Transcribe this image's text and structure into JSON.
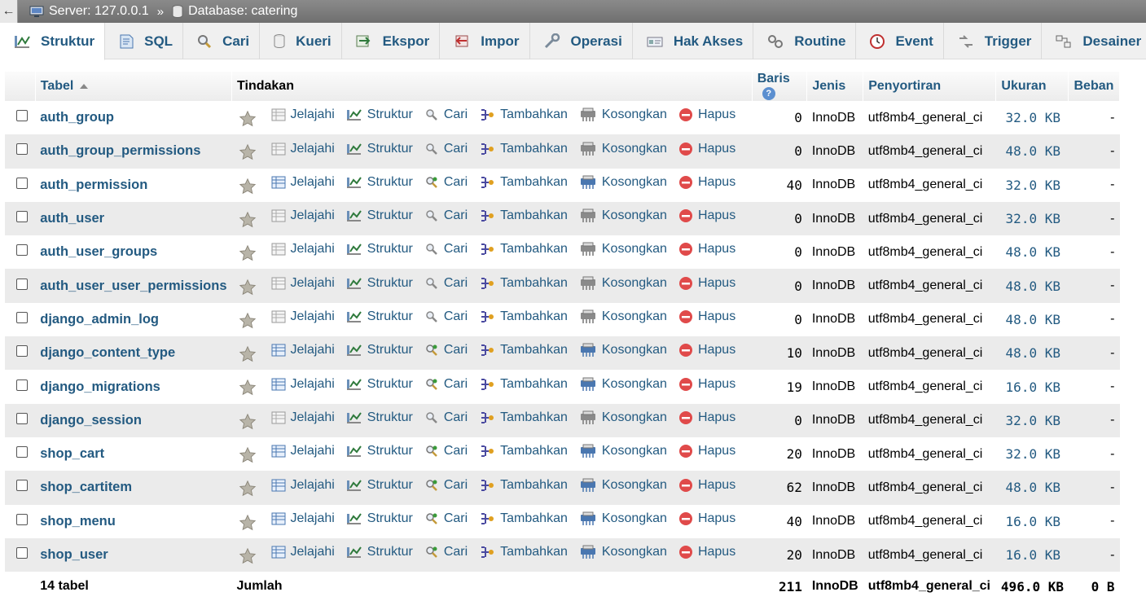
{
  "breadcrumb": {
    "back_label": "←",
    "server": "Server: 127.0.0.1",
    "separator": "»",
    "database": "Database: catering"
  },
  "tabs": [
    {
      "label": "Struktur",
      "icon": "structure-icon"
    },
    {
      "label": "SQL",
      "icon": "sql-icon"
    },
    {
      "label": "Cari",
      "icon": "search-icon"
    },
    {
      "label": "Kueri",
      "icon": "query-icon"
    },
    {
      "label": "Ekspor",
      "icon": "export-icon"
    },
    {
      "label": "Impor",
      "icon": "import-icon"
    },
    {
      "label": "Operasi",
      "icon": "wrench-icon"
    },
    {
      "label": "Hak Akses",
      "icon": "privileges-icon"
    },
    {
      "label": "Routine",
      "icon": "routines-icon"
    },
    {
      "label": "Event",
      "icon": "clock-icon"
    },
    {
      "label": "Trigger",
      "icon": "trigger-icon"
    },
    {
      "label": "Desainer",
      "icon": "designer-icon"
    }
  ],
  "table": {
    "headers": {
      "table": "Tabel",
      "actions": "Tindakan",
      "rows": "Baris",
      "type": "Jenis",
      "collation": "Penyortiran",
      "size": "Ukuran",
      "overhead": "Beban"
    },
    "actions": {
      "browse": "Jelajahi",
      "structure": "Struktur",
      "search": "Cari",
      "insert": "Tambahkan",
      "empty": "Kosongkan",
      "drop": "Hapus"
    },
    "rows": [
      {
        "name": "auth_group",
        "rows": "0",
        "type": "InnoDB",
        "collation": "utf8mb4_general_ci",
        "size": "32.0 KB",
        "overhead": "-"
      },
      {
        "name": "auth_group_permissions",
        "rows": "0",
        "type": "InnoDB",
        "collation": "utf8mb4_general_ci",
        "size": "48.0 KB",
        "overhead": "-"
      },
      {
        "name": "auth_permission",
        "rows": "40",
        "type": "InnoDB",
        "collation": "utf8mb4_general_ci",
        "size": "32.0 KB",
        "overhead": "-"
      },
      {
        "name": "auth_user",
        "rows": "0",
        "type": "InnoDB",
        "collation": "utf8mb4_general_ci",
        "size": "32.0 KB",
        "overhead": "-"
      },
      {
        "name": "auth_user_groups",
        "rows": "0",
        "type": "InnoDB",
        "collation": "utf8mb4_general_ci",
        "size": "48.0 KB",
        "overhead": "-"
      },
      {
        "name": "auth_user_user_permissions",
        "rows": "0",
        "type": "InnoDB",
        "collation": "utf8mb4_general_ci",
        "size": "48.0 KB",
        "overhead": "-"
      },
      {
        "name": "django_admin_log",
        "rows": "0",
        "type": "InnoDB",
        "collation": "utf8mb4_general_ci",
        "size": "48.0 KB",
        "overhead": "-"
      },
      {
        "name": "django_content_type",
        "rows": "10",
        "type": "InnoDB",
        "collation": "utf8mb4_general_ci",
        "size": "48.0 KB",
        "overhead": "-"
      },
      {
        "name": "django_migrations",
        "rows": "19",
        "type": "InnoDB",
        "collation": "utf8mb4_general_ci",
        "size": "16.0 KB",
        "overhead": "-"
      },
      {
        "name": "django_session",
        "rows": "0",
        "type": "InnoDB",
        "collation": "utf8mb4_general_ci",
        "size": "32.0 KB",
        "overhead": "-"
      },
      {
        "name": "shop_cart",
        "rows": "20",
        "type": "InnoDB",
        "collation": "utf8mb4_general_ci",
        "size": "32.0 KB",
        "overhead": "-"
      },
      {
        "name": "shop_cartitem",
        "rows": "62",
        "type": "InnoDB",
        "collation": "utf8mb4_general_ci",
        "size": "48.0 KB",
        "overhead": "-"
      },
      {
        "name": "shop_menu",
        "rows": "40",
        "type": "InnoDB",
        "collation": "utf8mb4_general_ci",
        "size": "16.0 KB",
        "overhead": "-"
      },
      {
        "name": "shop_user",
        "rows": "20",
        "type": "InnoDB",
        "collation": "utf8mb4_general_ci",
        "size": "16.0 KB",
        "overhead": "-"
      }
    ],
    "footer": {
      "count": "14 tabel",
      "sum_label": "Jumlah",
      "rows": "211",
      "type": "InnoDB",
      "collation": "utf8mb4_general_ci",
      "size": "496.0 KB",
      "overhead": "0 B"
    }
  }
}
